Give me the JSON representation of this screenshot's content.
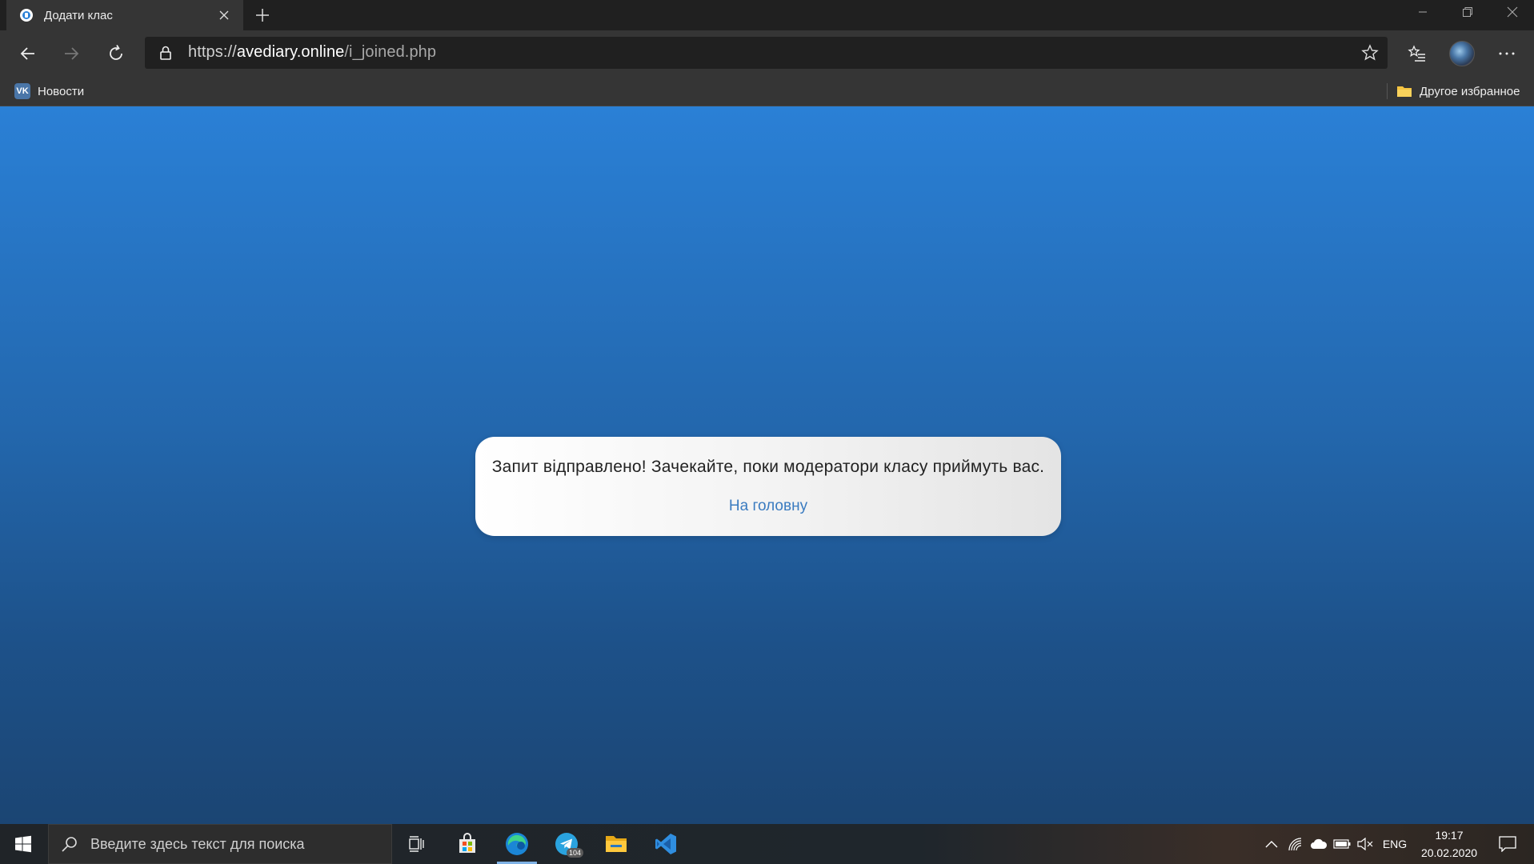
{
  "browser": {
    "tab": {
      "title": "Додати клас"
    },
    "address": {
      "scheme": "https://",
      "host": "avediary.online",
      "path": "/i_joined.php"
    },
    "bookmarks": {
      "left": [
        {
          "label": "Новости",
          "icon": "vk-icon"
        }
      ],
      "right": [
        {
          "label": "Другое избранное",
          "icon": "folder-icon"
        }
      ]
    }
  },
  "page": {
    "message": "Запит відправлено! Зачекайте, поки модератори класу приймуть вас.",
    "home_link": "На головну",
    "background_colors": [
      "#2a80d6",
      "#1b4573"
    ],
    "modal_background": "#ffffff",
    "link_color": "#3a7bc0"
  },
  "taskbar": {
    "search_placeholder": "Введите здесь текст для поиска",
    "apps": [
      {
        "name": "task-view",
        "icon": "task-view-icon"
      },
      {
        "name": "microsoft-store",
        "icon": "store-icon"
      },
      {
        "name": "edge",
        "icon": "edge-icon",
        "active": true
      },
      {
        "name": "telegram",
        "icon": "telegram-icon",
        "badge": "104"
      },
      {
        "name": "file-explorer",
        "icon": "folder-icon"
      },
      {
        "name": "vscode",
        "icon": "vscode-icon"
      }
    ],
    "tray": {
      "language": "ENG",
      "time": "19:17",
      "date": "20.02.2020"
    }
  }
}
